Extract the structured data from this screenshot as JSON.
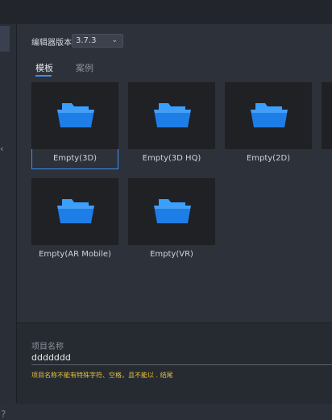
{
  "editor_version": {
    "label": "编辑器版本",
    "value": "3.7.3"
  },
  "tabs": [
    {
      "label": "模板",
      "active": true
    },
    {
      "label": "案例",
      "active": false
    }
  ],
  "templates": [
    {
      "label": "Empty(3D)",
      "selected": true,
      "icon": "folder-icon"
    },
    {
      "label": "Empty(3D HQ)",
      "selected": false,
      "icon": "folder-icon"
    },
    {
      "label": "Empty(2D)",
      "selected": false,
      "icon": "folder-icon"
    },
    {
      "label": "Empty(AR Mobile)",
      "selected": false,
      "icon": "folder-icon"
    },
    {
      "label": "Empty(VR)",
      "selected": false,
      "icon": "folder-icon"
    }
  ],
  "project": {
    "name_label": "项目名称",
    "name_value": "ddddddd",
    "warning": "项目名称不能有特殊字符、空格，且不能以 . 结尾"
  },
  "colors": {
    "accent": "#3d8ef0",
    "warning": "#e8c33a",
    "folder_top": "#3aa0ff",
    "folder_body": "#1e7ee8"
  }
}
